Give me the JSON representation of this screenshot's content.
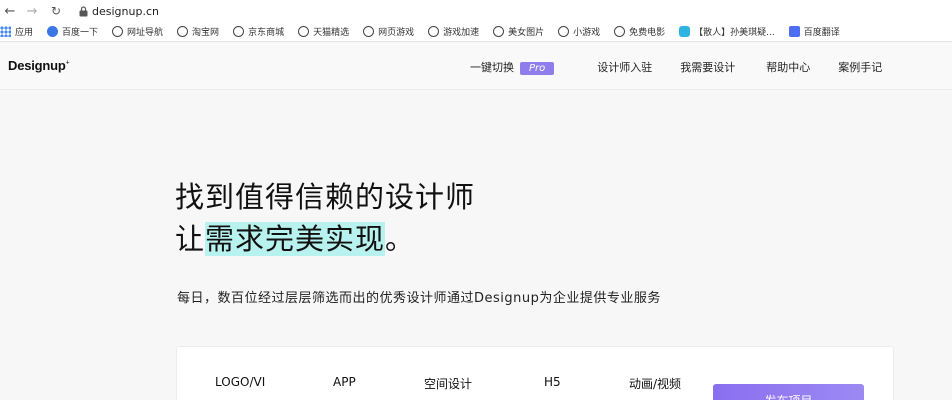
{
  "browser": {
    "url": "designup.cn",
    "bookmarks": [
      {
        "label": "应用",
        "icon": "apps-grid-icon"
      },
      {
        "label": "百度一下",
        "icon": "baidu-paw-icon"
      },
      {
        "label": "网址导航",
        "icon": "globe-icon"
      },
      {
        "label": "淘宝网",
        "icon": "globe-icon"
      },
      {
        "label": "京东商城",
        "icon": "globe-icon"
      },
      {
        "label": "天猫精选",
        "icon": "globe-icon"
      },
      {
        "label": "网页游戏",
        "icon": "globe-icon"
      },
      {
        "label": "游戏加速",
        "icon": "globe-icon"
      },
      {
        "label": "美女图片",
        "icon": "globe-icon"
      },
      {
        "label": "小游戏",
        "icon": "globe-icon"
      },
      {
        "label": "免费电影",
        "icon": "globe-icon"
      },
      {
        "label": "【散人】孙美琪疑...",
        "icon": "bilibili-icon"
      },
      {
        "label": "百度翻译",
        "icon": "baidu-translate-icon"
      }
    ]
  },
  "header": {
    "logo": "Designup",
    "logo_mark": "+",
    "nav": {
      "switch_label": "一键切换",
      "pro_badge": "Pro",
      "designer_join": "设计师入驻",
      "need_design": "我需要设计",
      "help_center": "帮助中心",
      "case_notes": "案例手记"
    }
  },
  "hero": {
    "title_line1": "找到值得信赖的设计师",
    "title_line2_prefix": "让",
    "title_line2_highlight": "需求完美实现",
    "title_line2_suffix": "。",
    "subtitle": "每日，数百位经过层层筛选而出的优秀设计师通过Designup为企业提供专业服务"
  },
  "categories": {
    "items": [
      "LOGO/VI",
      "APP",
      "空间设计",
      "H5",
      "动画/视频"
    ],
    "cta_label": "发布项目"
  },
  "colors": {
    "pro_badge": "#8e7dea",
    "highlight": "#b8f2ee",
    "cta": "#8a6ff0"
  }
}
